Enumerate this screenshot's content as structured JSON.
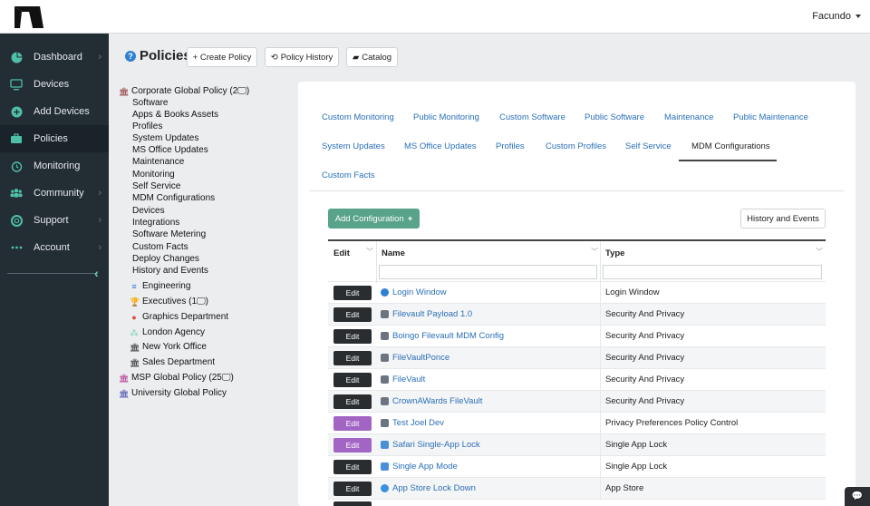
{
  "user": {
    "name": "Facundo"
  },
  "sidebar": {
    "items": [
      {
        "label": "Dashboard",
        "icon": "pie-chart-icon",
        "chevron": "›"
      },
      {
        "label": "Devices",
        "icon": "monitor-icon",
        "chevron": ""
      },
      {
        "label": "Add Devices",
        "icon": "plus-circle-icon",
        "chevron": ""
      },
      {
        "label": "Policies",
        "icon": "briefcase-icon",
        "chevron": ""
      },
      {
        "label": "Monitoring",
        "icon": "alarm-clock-icon",
        "chevron": ""
      },
      {
        "label": "Community",
        "icon": "users-icon",
        "chevron": "›"
      },
      {
        "label": "Support",
        "icon": "life-ring-icon",
        "chevron": "›"
      },
      {
        "label": "Account",
        "icon": "dots-icon",
        "chevron": "›"
      }
    ],
    "active": "Policies"
  },
  "header": {
    "title": "Policies",
    "buttons": {
      "create": "+ Create Policy",
      "history": "Policy History",
      "catalog": "Catalog"
    }
  },
  "tree": {
    "root": "Corporate Global Policy (2🖵)",
    "sections": [
      "Software",
      "Apps & Books Assets",
      "Profiles",
      "System Updates",
      "MS Office Updates",
      "Maintenance",
      "Monitoring",
      "Self Service",
      "MDM Configurations",
      "Devices",
      "Integrations",
      "Software Metering",
      "Custom Facts",
      "Deploy Changes",
      "History and Events"
    ],
    "children": [
      {
        "label": "Engineering",
        "icon": "database-icon",
        "color": "#2f6fd6"
      },
      {
        "label": "Executives (1🖵)",
        "icon": "trophy-icon",
        "color": "#e8a21a"
      },
      {
        "label": "Graphics Department",
        "icon": "user-icon",
        "color": "#e0463c"
      },
      {
        "label": "London Agency",
        "icon": "users-icon",
        "color": "#7fd3b6"
      },
      {
        "label": "New York Office",
        "icon": "bank-icon",
        "color": "#222222"
      },
      {
        "label": "Sales Department",
        "icon": "bank-icon",
        "color": "#222222"
      }
    ],
    "others": [
      {
        "label": "MSP Global Policy (25🖵)",
        "icon": "bank-icon",
        "color": "#b02a8a"
      },
      {
        "label": "University Global Policy",
        "icon": "bank-icon",
        "color": "#3b3fa8"
      }
    ]
  },
  "tabs": {
    "row1": [
      "Custom Monitoring",
      "Public Monitoring",
      "Custom Software",
      "Public Software",
      "Maintenance",
      "Public Maintenance"
    ],
    "row2": [
      "System Updates",
      "MS Office Updates",
      "Profiles",
      "Custom Profiles",
      "Self Service",
      "MDM Configurations"
    ],
    "row3": [
      "Custom Facts"
    ],
    "active": "MDM Configurations"
  },
  "actions": {
    "add": "Add Configuration",
    "history": "History and Events"
  },
  "table": {
    "columns": [
      "Edit",
      "Name",
      "Type"
    ],
    "edit_label": "Edit",
    "rows": [
      {
        "name": "Login Window",
        "type": "Login Window",
        "icon": "globe-icon",
        "icon_color": "#2f80d1",
        "purple": false
      },
      {
        "name": "Filevault Payload 1.0",
        "type": "Security And Privacy",
        "icon": "lock-icon",
        "icon_color": "#6b7480",
        "purple": false
      },
      {
        "name": "Boingo Filevault MDM Config",
        "type": "Security And Privacy",
        "icon": "lock-icon",
        "icon_color": "#6b7480",
        "purple": false
      },
      {
        "name": "FileVaultPonce",
        "type": "Security And Privacy",
        "icon": "lock-icon",
        "icon_color": "#6b7480",
        "purple": false
      },
      {
        "name": "FileVault",
        "type": "Security And Privacy",
        "icon": "lock-icon",
        "icon_color": "#6b7480",
        "purple": false
      },
      {
        "name": "CrownAWards FileVault",
        "type": "Security And Privacy",
        "icon": "lock-icon",
        "icon_color": "#6b7480",
        "purple": false
      },
      {
        "name": "Test Joel Dev",
        "type": "Privacy Preferences Policy Control",
        "icon": "lock-icon",
        "icon_color": "#6b7480",
        "purple": true
      },
      {
        "name": "Safari Single-App Lock",
        "type": "Single App Lock",
        "icon": "image-icon",
        "icon_color": "#4a90d9",
        "purple": true
      },
      {
        "name": "Single App Mode",
        "type": "Single App Lock",
        "icon": "image-icon",
        "icon_color": "#4a90d9",
        "purple": false
      },
      {
        "name": "App Store Lock Down",
        "type": "App Store",
        "icon": "app-store-icon",
        "icon_color": "#3b8fe0",
        "purple": false
      }
    ]
  },
  "colors": {
    "accent": "#58a38a",
    "link": "#2a6fb8",
    "sidebar": "#222d34",
    "purple": "#a265c4"
  }
}
